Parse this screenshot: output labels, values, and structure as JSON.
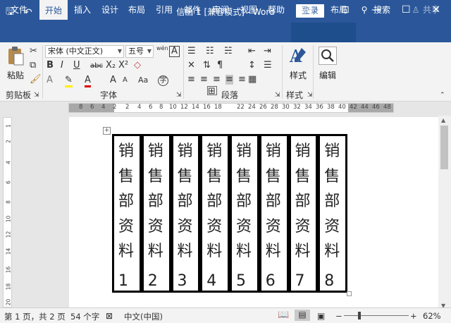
{
  "titlebar": {
    "doc_title": "信函 1 [兼容模式] - Word",
    "login": "登录",
    "qat": {
      "save": "🖫",
      "undo": "↶",
      "redo": "↻",
      "more": "≡"
    },
    "controls": {
      "ribbon_opts": "⊡",
      "minimize": "—",
      "maximize": "☐",
      "close": "✕"
    }
  },
  "tabs": [
    "文件",
    "开始",
    "插入",
    "设计",
    "布局",
    "引用",
    "邮件",
    "审阅",
    "视图",
    "帮助",
    "设计",
    "布局"
  ],
  "active_tab": "开始",
  "search": {
    "icon": "⚲",
    "label": "搜索"
  },
  "share": {
    "icon": "♙",
    "label": "共享"
  },
  "ribbon": {
    "clipboard": {
      "paste": "粘贴",
      "group": "剪贴板"
    },
    "font": {
      "font_name": "宋体 (中文正文)",
      "font_size": "五号",
      "wen": "wén",
      "a_box": "A",
      "bold": "B",
      "italic": "I",
      "underline": "U",
      "strike": "abc",
      "sub": "X₂",
      "sup": "X²",
      "font_color": "A",
      "group": "字体"
    },
    "paragraph": {
      "group": "段落"
    },
    "styles": {
      "label": "样式",
      "group": "样式"
    },
    "editing": {
      "label": "编辑"
    }
  },
  "ruler_top": [
    "8",
    "6",
    "4",
    "2",
    "2",
    "4",
    "6",
    "8",
    "10",
    "12",
    "14",
    "16",
    "18",
    "22",
    "24",
    "26",
    "28",
    "30",
    "32",
    "34",
    "36",
    "38",
    "40",
    "42",
    "44",
    "46",
    "48"
  ],
  "ruler_left": [
    "1",
    "2",
    "4",
    "6",
    "8",
    "10",
    "12",
    "14",
    "16",
    "18",
    "20"
  ],
  "table": {
    "columns": [
      {
        "text": "销售部资料",
        "num": "1"
      },
      {
        "text": "销售部资料",
        "num": "2"
      },
      {
        "text": "销售部资料",
        "num": "3"
      },
      {
        "text": "销售部资料",
        "num": "4"
      },
      {
        "text": "销售部资料",
        "num": "5"
      },
      {
        "text": "销售部资料",
        "num": "6"
      },
      {
        "text": "销售部资料",
        "num": "7"
      },
      {
        "text": "销售部资料",
        "num": "8"
      }
    ]
  },
  "status": {
    "page": "第 1 页，共 2 页",
    "words": "54 个字",
    "lang": "中文(中国)",
    "zoom": "62%",
    "minus": "−",
    "plus": "+"
  }
}
